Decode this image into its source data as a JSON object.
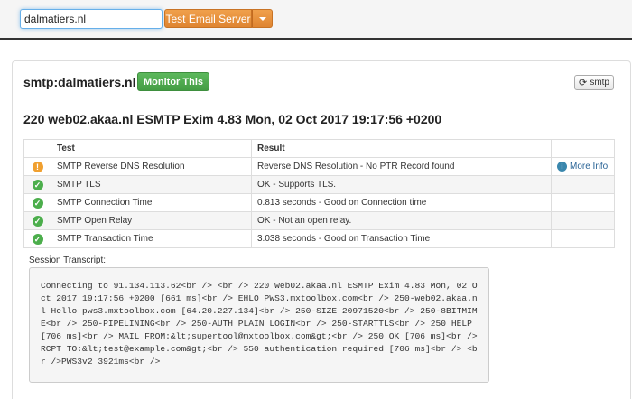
{
  "search": {
    "value": "dalmatiers.nl"
  },
  "toolbar": {
    "test_button_label": "Test Email Server"
  },
  "panel": {
    "title": "smtp:dalmatiers.nl",
    "monitor_label": "Monitor This",
    "refresh_label": "smtp",
    "banner": "220 web02.akaa.nl ESMTP Exim 4.83 Mon, 02 Oct 2017 19:17:56 +0200"
  },
  "table": {
    "headers": [
      "",
      "Test",
      "Result",
      ""
    ],
    "rows": [
      {
        "status": "warning",
        "test": "SMTP Reverse DNS Resolution",
        "result": "Reverse DNS Resolution - No PTR Record found",
        "action": "More Info"
      },
      {
        "status": "ok",
        "test": "SMTP TLS",
        "result": "OK - Supports TLS.",
        "action": ""
      },
      {
        "status": "ok",
        "test": "SMTP Connection Time",
        "result": "0.813 seconds - Good on Connection time",
        "action": ""
      },
      {
        "status": "ok",
        "test": "SMTP Open Relay",
        "result": "OK - Not an open relay.",
        "action": ""
      },
      {
        "status": "ok",
        "test": "SMTP Transaction Time",
        "result": "3.038 seconds - Good on Transaction Time",
        "action": ""
      }
    ]
  },
  "transcript": {
    "label": "Session Transcript:",
    "text": "Connecting to 91.134.113.62<br /> <br /> 220 web02.akaa.nl ESMTP Exim 4.83 Mon, 02 Oct 2017 19:17:56 +0200 [661 ms]<br /> EHLO PWS3.mxtoolbox.com<br /> 250-web02.akaa.nl Hello pws3.mxtoolbox.com [64.20.227.134]<br /> 250-SIZE 20971520<br /> 250-8BITMIME<br /> 250-PIPELINING<br /> 250-AUTH PLAIN LOGIN<br /> 250-STARTTLS<br /> 250 HELP [706 ms]<br /> MAIL FROM:&lt;supertool@mxtoolbox.com&gt;<br /> 250 OK [706 ms]<br /> RCPT TO:&lt;test@example.com&gt;<br /> 550 authentication required [706 ms]<br /> <br />PWS3v2 3921ms<br />"
  },
  "colors": {
    "accent_orange": "#e38d3b",
    "monitor_green": "#5cb85c",
    "warning": "#f0a030",
    "ok": "#4cae4c",
    "link": "#2a6496"
  },
  "icons": {
    "warning": "exclamation-circle-icon",
    "ok": "check-circle-icon",
    "info": "info-circle-icon",
    "refresh": "refresh-icon",
    "dropdown": "caret-down-icon"
  }
}
